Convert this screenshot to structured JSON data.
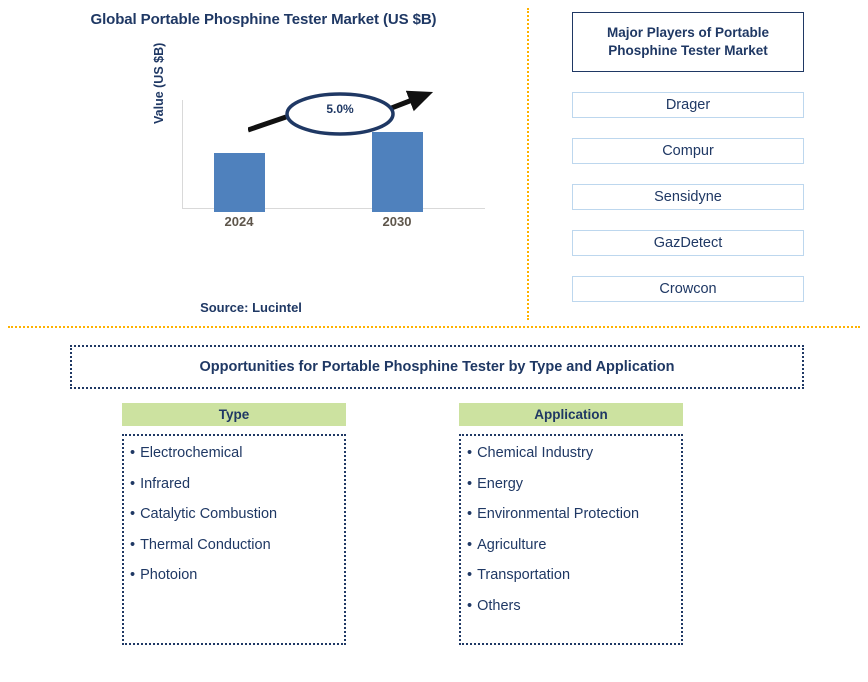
{
  "chart_panel": {
    "title": "Global Portable Phosphine Tester Market (US $B)",
    "y_axis_label": "Value (US $B)",
    "cagr_label": "5.0%",
    "source": "Source: Lucintel"
  },
  "chart_data": {
    "type": "bar",
    "title": "Global Portable Phosphine Tester Market (US $B)",
    "categories": [
      "2024",
      "2030"
    ],
    "values": [
      0.74,
      1.0
    ],
    "xlabel": "",
    "ylabel": "Value (US $B)",
    "ylim": [
      0,
      1.35
    ],
    "grid": false,
    "legend": null,
    "bar_color": "#4F81BD",
    "annotations": [
      {
        "text": "5.0%",
        "kind": "cagr-arrow-ellipse",
        "from": "2024",
        "to": "2030"
      }
    ]
  },
  "players": {
    "header": "Major Players of Portable Phosphine Tester Market",
    "items": [
      {
        "name": "Drager"
      },
      {
        "name": "Compur"
      },
      {
        "name": "Sensidyne"
      },
      {
        "name": "GazDetect"
      },
      {
        "name": "Crowcon"
      }
    ]
  },
  "opportunities": {
    "banner": "Opportunities for Portable Phosphine Tester by Type and Application",
    "columns": [
      {
        "header": "Type",
        "items": [
          "Electrochemical",
          "Infrared",
          "Catalytic Combustion",
          "Thermal Conduction",
          "Photoion"
        ]
      },
      {
        "header": "Application",
        "items": [
          "Chemical Industry",
          "Energy",
          "Environmental Protection",
          "Agriculture",
          "Transportation",
          "Others"
        ]
      }
    ]
  },
  "colors": {
    "navy": "#1F3864",
    "bar_blue": "#4F81BD",
    "divider_gold": "#FFB200",
    "header_green": "#CCE2A0",
    "player_border": "#BDD7EE",
    "tick_gray": "#5E564B"
  }
}
